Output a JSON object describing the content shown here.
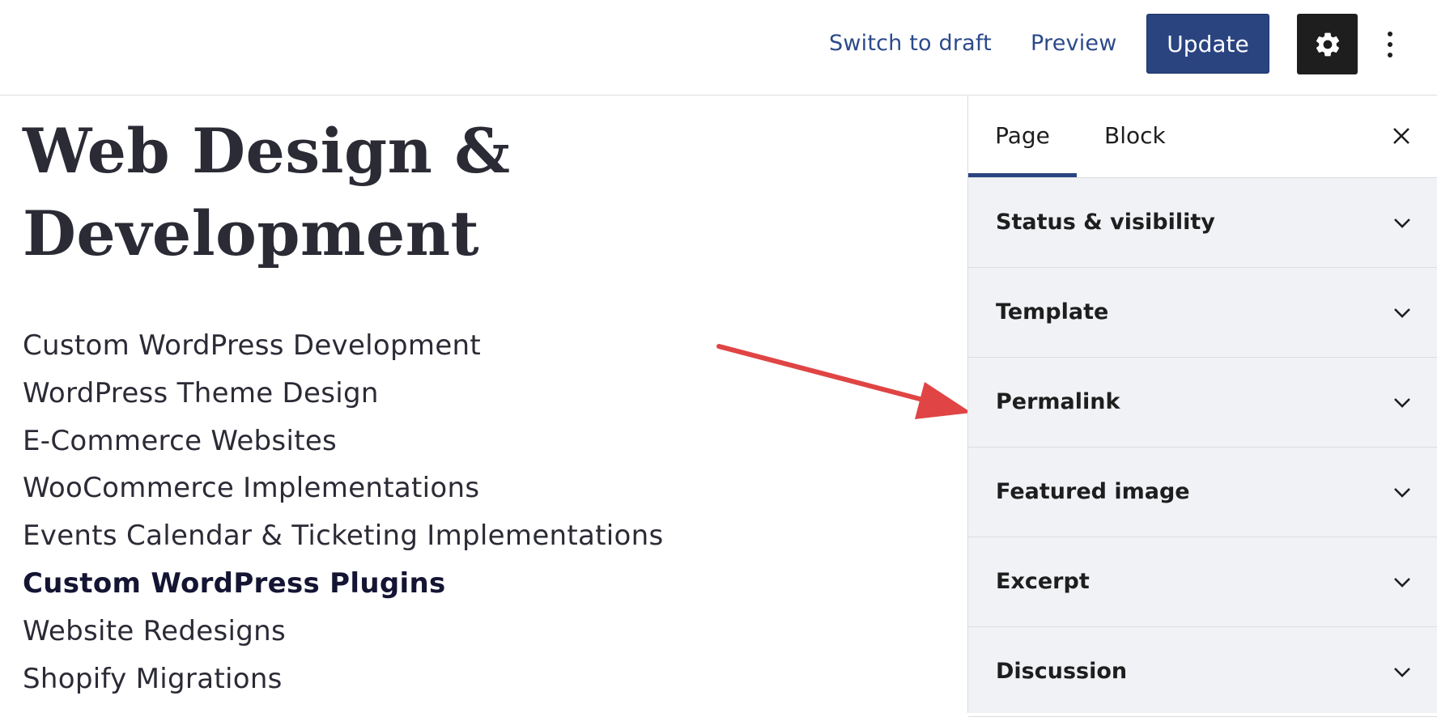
{
  "toolbar": {
    "switch_to_draft": "Switch to draft",
    "preview": "Preview",
    "update": "Update",
    "settings_icon": "gear-icon",
    "more_icon": "vertical-ellipsis-icon"
  },
  "content": {
    "title": "Web Design & Development",
    "services": [
      "Custom WordPress Development",
      "WordPress Theme Design",
      "E-Commerce Websites",
      "WooCommerce Implementations",
      "Events Calendar & Ticketing Implementations",
      "Custom WordPress Plugins",
      "Website Redesigns",
      "Shopify Migrations"
    ],
    "active_service_index": 5
  },
  "sidebar": {
    "tabs": [
      {
        "label": "Page",
        "active": true
      },
      {
        "label": "Block",
        "active": false
      }
    ],
    "close_icon": "close-icon",
    "panels": [
      {
        "label": "Status & visibility"
      },
      {
        "label": "Template"
      },
      {
        "label": "Permalink"
      },
      {
        "label": "Featured image"
      },
      {
        "label": "Excerpt"
      },
      {
        "label": "Discussion"
      }
    ]
  },
  "annotation": {
    "arrow_color": "#e04444",
    "target": "Permalink"
  },
  "colors": {
    "accent": "#2a4480",
    "link": "#2c4a8a",
    "dark": "#1e1e1e",
    "sidebar_bg": "#f0f2f5"
  }
}
